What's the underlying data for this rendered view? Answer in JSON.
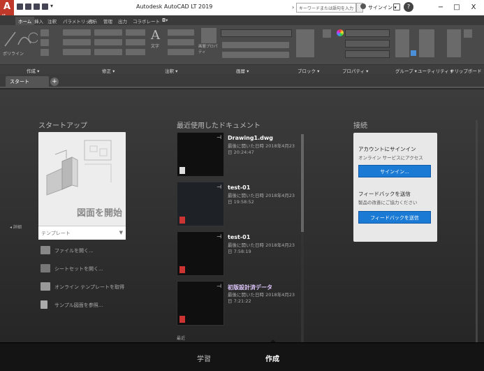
{
  "app": {
    "title": "Autodesk AutoCAD LT 2019",
    "logo_letter": "A",
    "logo_sub": "LT",
    "search_placeholder": "キーワードまたは語句を入力",
    "signin_label": "サインイン",
    "window_controls": [
      "−",
      "□",
      "X"
    ]
  },
  "ribbon": {
    "tabs": [
      {
        "label": "ホーム"
      },
      {
        "label": "挿入"
      },
      {
        "label": "注釈"
      },
      {
        "label": "パラメトリック"
      },
      {
        "label": "表示"
      },
      {
        "label": "管理"
      },
      {
        "label": "出力"
      },
      {
        "label": "コラボレート"
      },
      {
        "label": "◘▾"
      }
    ],
    "panels": [
      {
        "label": "作成 ▾"
      },
      {
        "label": "修正 ▾"
      },
      {
        "label": "注釈 ▾"
      },
      {
        "label": "画層 ▾"
      },
      {
        "label": "ブロック ▾"
      },
      {
        "label": "プロパティ ▾"
      },
      {
        "label": "グループ ▾"
      },
      {
        "label": "ユーティリティ ▾"
      },
      {
        "label": "クリップボード"
      }
    ],
    "tool_labels": {
      "polyline": "ポリライン",
      "text": "文字",
      "layer_props": "画層プロパティ"
    }
  },
  "doc_tabs": {
    "start": "スタート",
    "add": "+"
  },
  "start": {
    "section_title": "スタートアップ",
    "start_drawing": "図面を開始",
    "template_value": "テンプレート",
    "template_arrow": "▼",
    "actions": [
      {
        "label": "ファイルを開く..."
      },
      {
        "label": "シートセットを開く..."
      },
      {
        "label": "オンライン テンプレートを取得"
      },
      {
        "label": "サンプル図面を参照..."
      }
    ],
    "collapse_label": "◂ 詳細"
  },
  "recent": {
    "section_title": "最近使用したドキュメント",
    "docs": [
      {
        "name": "Drawing1.dwg",
        "date": "最後に開いた日時 2018年4月23日 20:24:47",
        "pin": "⊣"
      },
      {
        "name": "test-01",
        "date": "最後に開いた日時 2018年4月23日 19:58:52",
        "pin": "⊣"
      },
      {
        "name": "test-01",
        "date": "最後に開いた日時 2018年4月23日 7:58:19",
        "pin": "⊣"
      },
      {
        "name": "初版設計済データ",
        "date": "最後に開いた日時 2018年4月23日 7:21:22",
        "pin": "⊣"
      }
    ],
    "footer": "最近"
  },
  "connect": {
    "section_title": "接続",
    "account_head": "アカウントにサインイン",
    "account_sub": "オンライン サービスにアクセス",
    "signin_btn": "サインイン...",
    "feedback_head": "フィードバックを送信",
    "feedback_sub": "製品の改善にご協力ください",
    "feedback_btn": "フィードバックを送信"
  },
  "bottom": {
    "learn": "学習",
    "create": "作成"
  }
}
